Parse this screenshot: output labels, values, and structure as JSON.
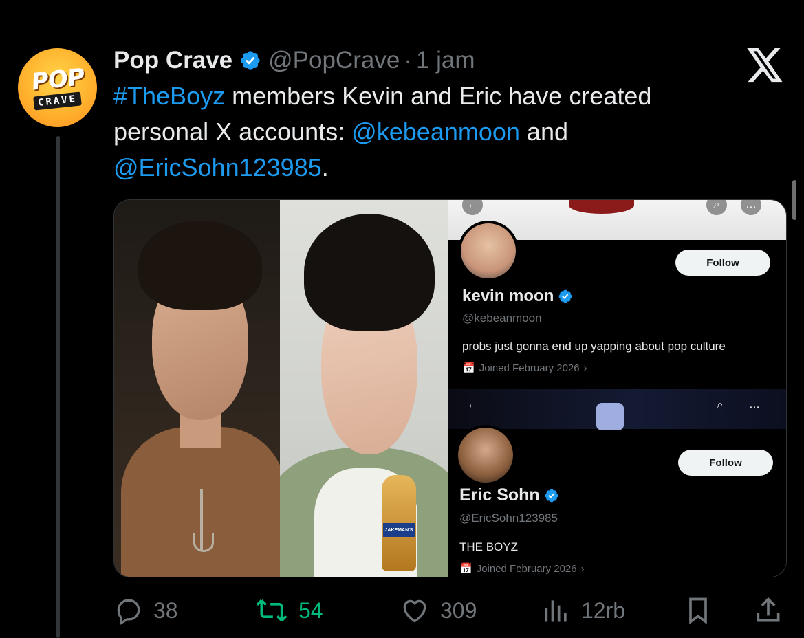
{
  "account": {
    "display_name": "Pop Crave",
    "handle": "@PopCrave",
    "separator": "·",
    "time": "1 jam",
    "avatar_text_top": "POP",
    "avatar_text_bottom": "CRAVE"
  },
  "tweet": {
    "hashtag": "#TheBoyz",
    "text_part1": " members Kevin and Eric have created personal X accounts: ",
    "mention1": "@kebeanmoon",
    "text_part2": " and ",
    "mention2": "@EricSohn123985",
    "text_part3": "."
  },
  "screenshot1": {
    "follow_label": "Follow",
    "name": "kevin moon",
    "handle": "@kebeanmoon",
    "bio": "probs just gonna end up yapping about pop culture",
    "joined": "Joined February 2026"
  },
  "screenshot2": {
    "follow_label": "Follow",
    "name": "Eric Sohn",
    "handle": "@EricSohn123985",
    "bio": "THE BOYZ",
    "joined": "Joined February 2026"
  },
  "photo2": {
    "bottle_label": "JAKEMAN'S"
  },
  "actions": {
    "replies": "38",
    "reposts": "54",
    "likes": "309",
    "views": "12rb"
  },
  "colors": {
    "background": "#000000",
    "link": "#1d9bf0",
    "muted": "#71767b",
    "repost_active": "#00ba7c",
    "verified": "#1d9bf0"
  },
  "icons": [
    "verified-badge-icon",
    "x-logo-icon",
    "reply-icon",
    "repost-icon",
    "like-icon",
    "views-icon",
    "bookmark-icon",
    "share-icon",
    "back-arrow-icon",
    "search-icon",
    "more-icon",
    "calendar-icon",
    "chevron-right-icon"
  ]
}
